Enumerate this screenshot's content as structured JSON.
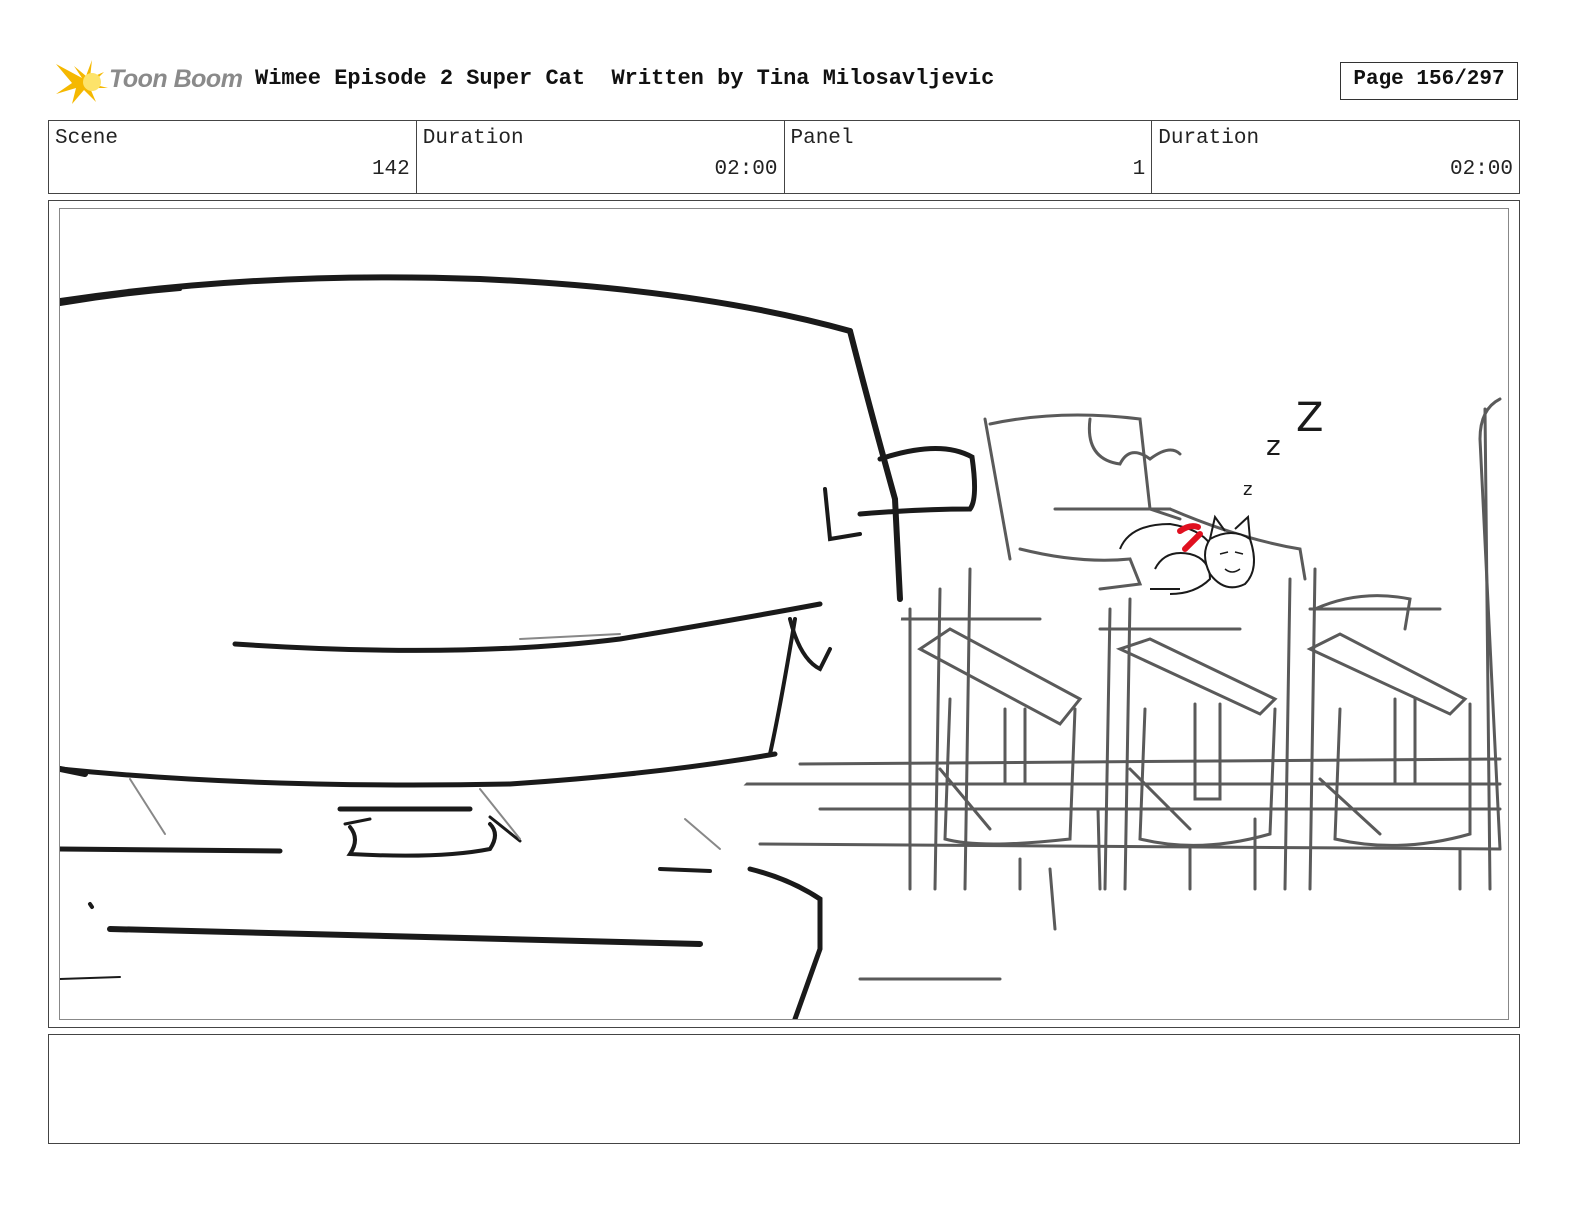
{
  "header": {
    "logo_text": "Toon Boom",
    "logo_colors": {
      "burst": "#f5b800",
      "burst_light": "#fde36a",
      "text": "#8a8a8a"
    },
    "title": "Wimee Episode 2 Super Cat  Written by Tina Milosavljevic",
    "page": "Page 156/297"
  },
  "info": {
    "scene_label": "Scene",
    "scene_value": "142",
    "scene_duration_label": "Duration",
    "scene_duration_value": "02:00",
    "panel_label": "Panel",
    "panel_value": "1",
    "panel_duration_label": "Duration",
    "panel_duration_value": "02:00"
  },
  "sketch": {
    "sleep_text": [
      "z",
      "z",
      "Z"
    ],
    "colors": {
      "ink": "#1a1a1a",
      "pencil": "#5a5a5a",
      "accent": "#e01020"
    }
  },
  "notes": {
    "text": ""
  }
}
